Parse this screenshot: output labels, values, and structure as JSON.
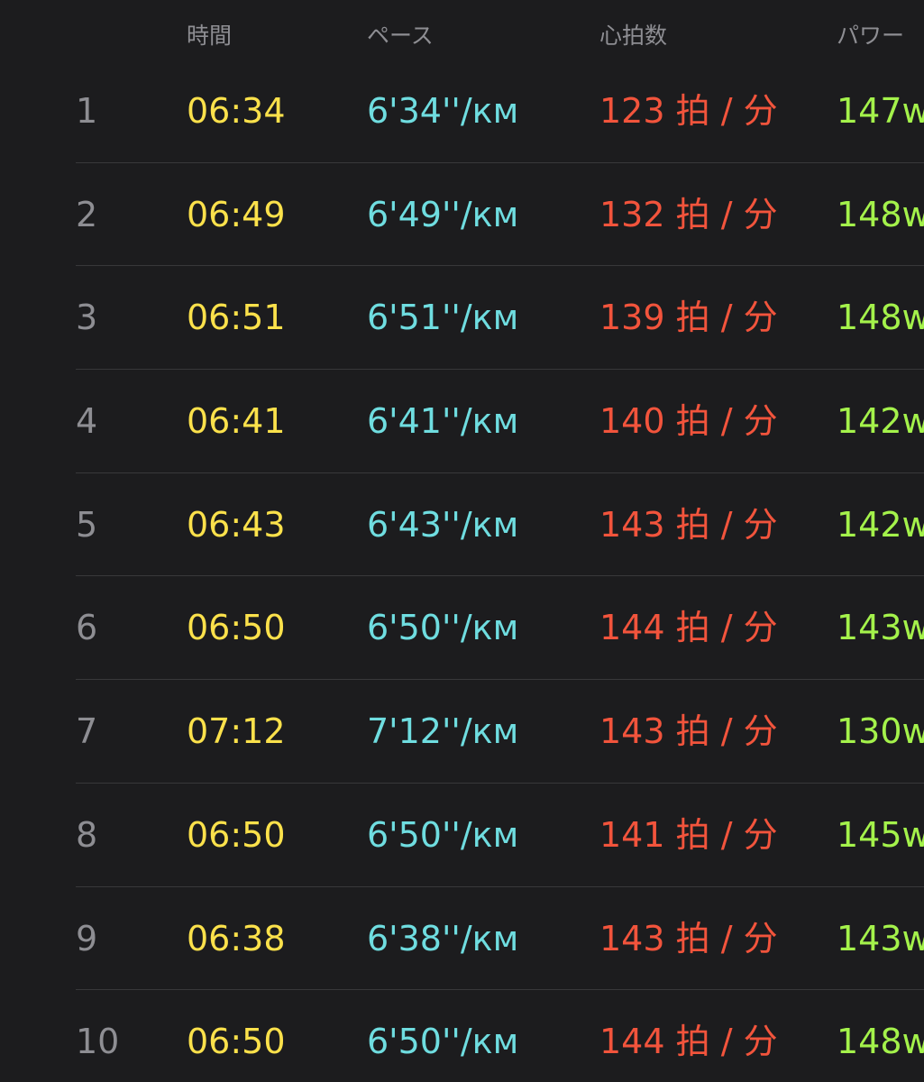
{
  "header": {
    "col_time": "時間",
    "col_pace": "ペース",
    "col_hr": "心拍数",
    "col_power": "パワー"
  },
  "colors": {
    "background": "#1c1c1e",
    "index": "#8e8e93",
    "time": "#fbe14b",
    "pace": "#6fdde0",
    "heart_rate": "#f2543c",
    "power": "#a4f24b",
    "divider": "#38383a"
  },
  "rows": [
    {
      "idx": "1",
      "time": "06:34",
      "pace": "6'34''/км",
      "hr": "123 拍 / 分",
      "power": "147w"
    },
    {
      "idx": "2",
      "time": "06:49",
      "pace": "6'49''/км",
      "hr": "132 拍 / 分",
      "power": "148w"
    },
    {
      "idx": "3",
      "time": "06:51",
      "pace": "6'51''/км",
      "hr": "139 拍 / 分",
      "power": "148w"
    },
    {
      "idx": "4",
      "time": "06:41",
      "pace": "6'41''/км",
      "hr": "140 拍 / 分",
      "power": "142w"
    },
    {
      "idx": "5",
      "time": "06:43",
      "pace": "6'43''/км",
      "hr": "143 拍 / 分",
      "power": "142w"
    },
    {
      "idx": "6",
      "time": "06:50",
      "pace": "6'50''/км",
      "hr": "144 拍 / 分",
      "power": "143w"
    },
    {
      "idx": "7",
      "time": "07:12",
      "pace": "7'12''/км",
      "hr": "143 拍 / 分",
      "power": "130w"
    },
    {
      "idx": "8",
      "time": "06:50",
      "pace": "6'50''/км",
      "hr": "141 拍 / 分",
      "power": "145w"
    },
    {
      "idx": "9",
      "time": "06:38",
      "pace": "6'38''/км",
      "hr": "143 拍 / 分",
      "power": "143w"
    },
    {
      "idx": "10",
      "time": "06:50",
      "pace": "6'50''/км",
      "hr": "144 拍 / 分",
      "power": "148w"
    }
  ]
}
